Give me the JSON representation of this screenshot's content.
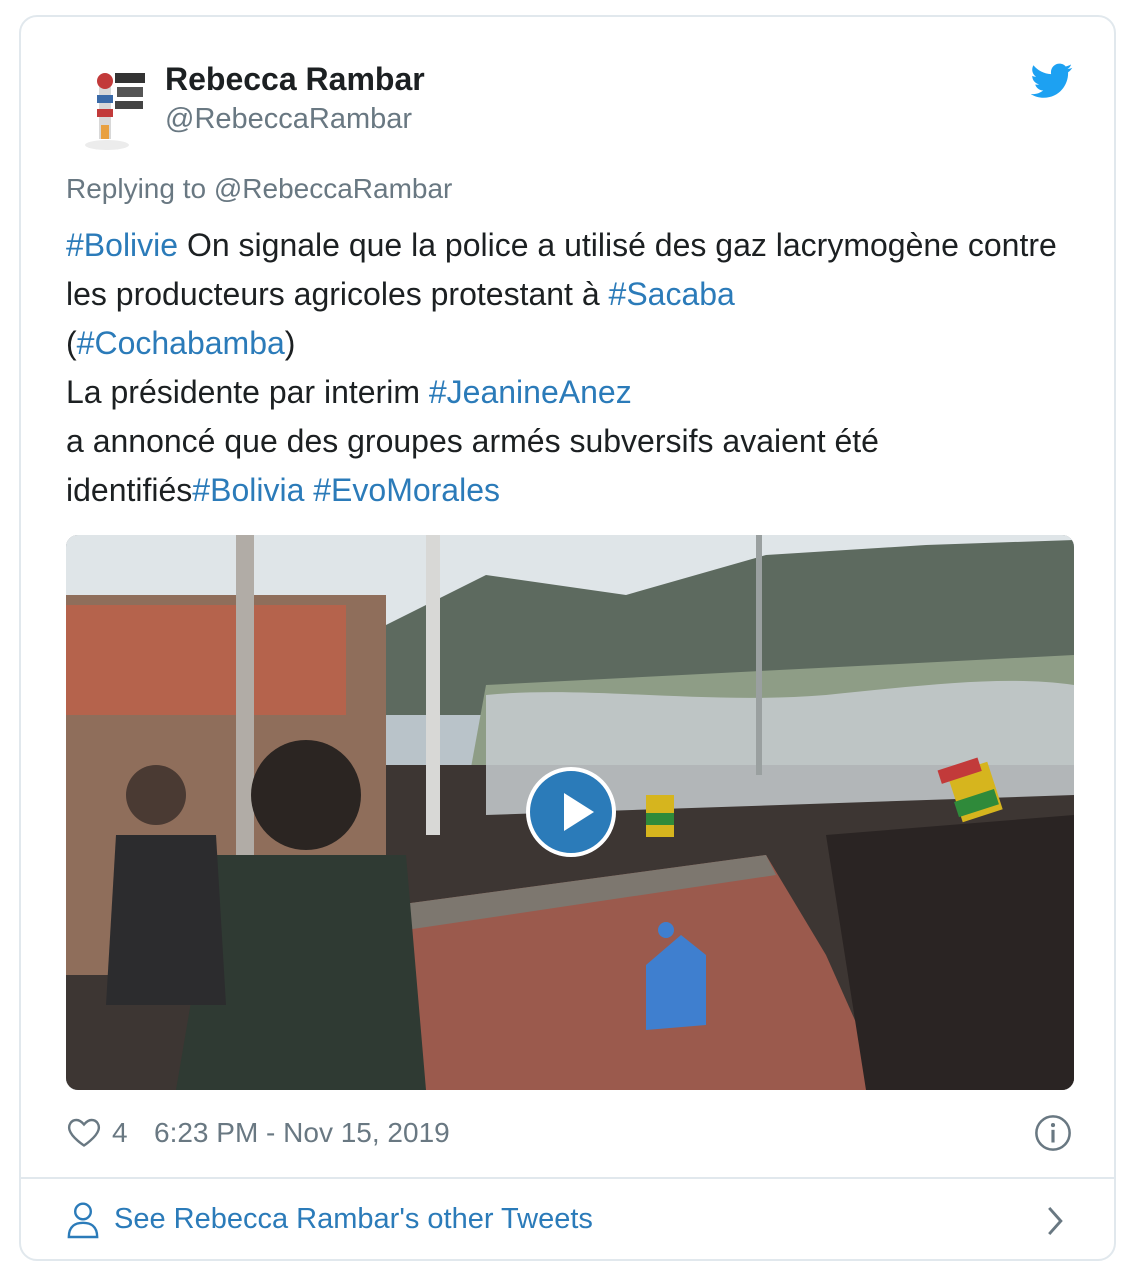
{
  "author": {
    "name": "Rebecca Rambar",
    "handle": "@RebeccaRambar"
  },
  "tweet": {
    "replying_to": "Replying to @RebeccaRambar",
    "segments": [
      {
        "text": "#Bolivie",
        "tag": true
      },
      {
        "text": " On signale que la police a utilisé des gaz lacrymogène contre les producteurs agricoles protestant à ",
        "tag": false
      },
      {
        "text": "#Sacaba",
        "tag": true
      },
      {
        "text": "\n(",
        "tag": false
      },
      {
        "text": "#Cochabamba",
        "tag": true
      },
      {
        "text": ")\nLa présidente par interim ",
        "tag": false
      },
      {
        "text": "#JeanineAnez",
        "tag": true
      },
      {
        "text": "\na annoncé que des groupes armés subversifs avaient été identifiés",
        "tag": false
      },
      {
        "text": "#Bolivia",
        "tag": true
      },
      {
        "text": " ",
        "tag": false
      },
      {
        "text": "#EvoMorales",
        "tag": true
      }
    ]
  },
  "footer": {
    "likes": "4",
    "timestamp": "6:23 PM - Nov 15, 2019"
  },
  "more_tweets": {
    "label": "See Rebecca Rambar's other Tweets"
  },
  "icons": {
    "bird": "twitter-bird-icon",
    "heart": "heart-icon",
    "info": "info-icon",
    "person": "person-icon",
    "chevron": "chevron-right-icon",
    "play": "play-icon"
  },
  "colors": {
    "link": "#2b7bb9",
    "muted": "#697882",
    "text": "#1c2022",
    "twitter_blue": "#1da1f2"
  }
}
